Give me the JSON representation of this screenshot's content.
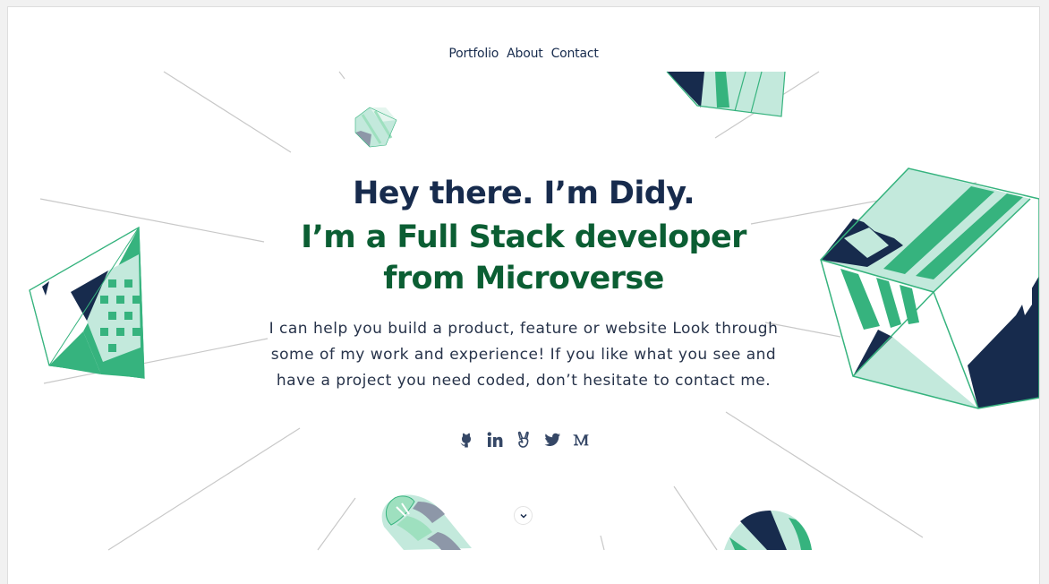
{
  "nav": {
    "items": [
      {
        "label": "Portfolio"
      },
      {
        "label": "About"
      },
      {
        "label": "Contact"
      }
    ]
  },
  "hero": {
    "greeting": "Hey there. I’m Didy.",
    "headline": "I’m a Full Stack developer from Microverse",
    "intro": "I can help you build a product, feature or website Look through some of my work and experience! If you like what you see and have a project you need coded, don’t hesitate to contact me."
  },
  "social": [
    {
      "icon": "github-icon"
    },
    {
      "icon": "linkedin-icon"
    },
    {
      "icon": "angellist-icon"
    },
    {
      "icon": "twitter-icon"
    },
    {
      "icon": "medium-icon"
    }
  ],
  "scroll": {
    "icon": "chevron-down-icon"
  },
  "colors": {
    "navy": "#172b4d",
    "green_dark": "#0b5e33",
    "green": "#36b37e",
    "mint": "#c3e9dc",
    "light_mint": "#9ee0bf",
    "slate": "#8d97a8",
    "ray": "#cccccc"
  }
}
